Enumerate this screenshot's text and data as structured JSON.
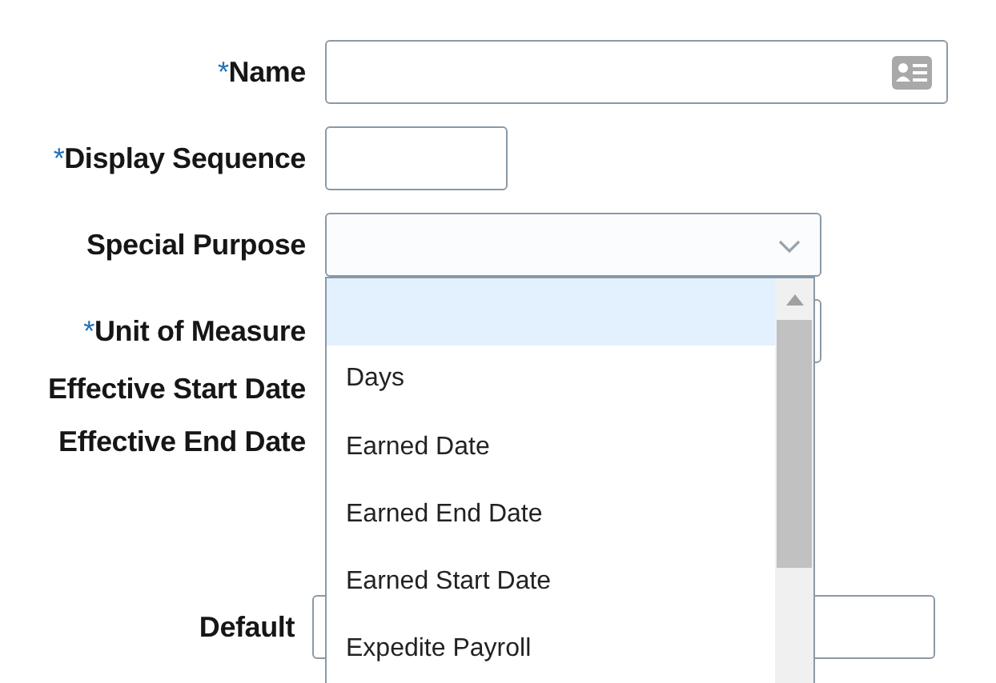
{
  "fields": [
    {
      "required_mark": "*",
      "label": "Name",
      "kind": "card-field"
    },
    {
      "required_mark": "*",
      "label": "Display Sequence",
      "kind": "number-field"
    },
    {
      "label": "Special Purpose",
      "kind": "select",
      "expanded": true
    },
    {
      "required_mark": "*",
      "label": "Unit of Measure",
      "kind": "text-field"
    },
    {
      "label": "Effective Start Date",
      "kind": "none"
    },
    {
      "label": "Effective End Date",
      "kind": "none"
    }
  ],
  "dropdown": {
    "options": [
      {
        "selected": true
      },
      {
        "label": "Days",
        "selected": false
      },
      {
        "label": "Earned Date",
        "selected": false
      },
      {
        "label": "Earned End Date",
        "selected": false
      },
      {
        "label": "Earned Start Date",
        "selected": false
      },
      {
        "label": "Expedite Payroll",
        "selected": false
      }
    ]
  },
  "default_field": {
    "label": "Default"
  }
}
